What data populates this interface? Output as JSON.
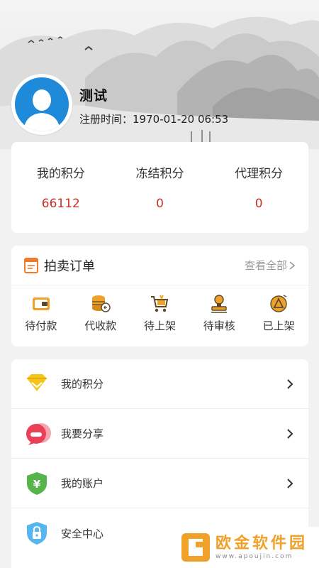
{
  "profile": {
    "name": "测试",
    "register_label": "注册时间：",
    "register_time": "1970-01-20 06:53"
  },
  "stats": [
    {
      "label": "我的积分",
      "value": "66112"
    },
    {
      "label": "冻结积分",
      "value": "0"
    },
    {
      "label": "代理积分",
      "value": "0"
    }
  ],
  "orders": {
    "title": "拍卖订单",
    "see_all": "查看全部",
    "items": [
      {
        "label": "待付款",
        "icon": "wallet-icon"
      },
      {
        "label": "代收款",
        "icon": "coin-stack-icon"
      },
      {
        "label": "待上架",
        "icon": "cart-icon"
      },
      {
        "label": "待审核",
        "icon": "stamp-icon"
      },
      {
        "label": "已上架",
        "icon": "upload-icon"
      }
    ]
  },
  "menu": [
    {
      "label": "我的积分",
      "icon": "diamond-icon"
    },
    {
      "label": "我要分享",
      "icon": "share-chat-icon"
    },
    {
      "label": "我的账户",
      "icon": "yuan-shield-icon"
    },
    {
      "label": "安全中心",
      "icon": "lock-shield-icon"
    }
  ],
  "watermark": {
    "name": "欧金软件园",
    "url": "www.apoujin.com"
  },
  "colors": {
    "accent_red": "#c8302a",
    "avatar_blue": "#1f8ad9",
    "icon_orange": "#f0a12a"
  }
}
